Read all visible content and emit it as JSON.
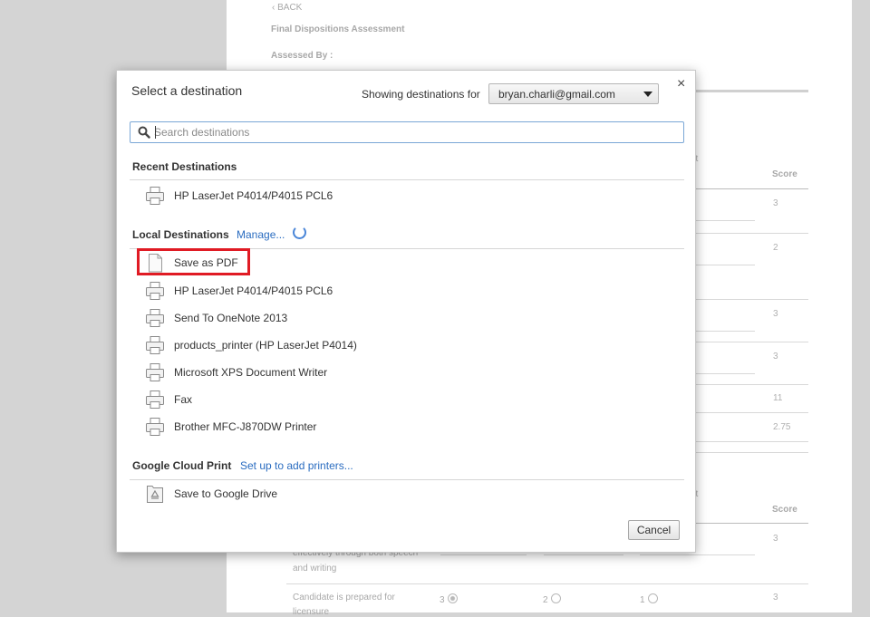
{
  "background": {
    "back_label": "BACK",
    "assessment_title": "Final Dispositions Assessment",
    "assessed_by": "Assessed By :",
    "score_header": "Score",
    "et_fragment": "et",
    "scores_upper": [
      "3",
      "2",
      "3",
      "3",
      "11",
      "2.75"
    ],
    "scores_lower": [
      "3",
      "3"
    ],
    "row_text_1": "effectively through both speech",
    "row_text_2": "and writing",
    "row_text_3": "Candidate is prepared for",
    "row_text_4": "licensure",
    "radio_labels": [
      "3",
      "2",
      "1"
    ]
  },
  "dialog": {
    "title": "Select a destination",
    "showing_for_label": "Showing destinations for",
    "account": "bryan.charli@gmail.com",
    "close_glyph": "×",
    "search_placeholder": "Search destinations",
    "recent": {
      "heading": "Recent Destinations",
      "items": [
        {
          "label": "HP LaserJet P4014/P4015 PCL6",
          "icon": "printer-icon"
        }
      ]
    },
    "local": {
      "heading": "Local Destinations",
      "manage_link": "Manage...",
      "items": [
        {
          "label": "Save as PDF",
          "icon": "document-icon"
        },
        {
          "label": "HP LaserJet P4014/P4015 PCL6",
          "icon": "printer-icon"
        },
        {
          "label": "Send To OneNote 2013",
          "icon": "printer-icon"
        },
        {
          "label": "products_printer (HP LaserJet P4014)",
          "icon": "printer-icon"
        },
        {
          "label": "Microsoft XPS Document Writer",
          "icon": "printer-icon"
        },
        {
          "label": "Fax",
          "icon": "printer-icon"
        },
        {
          "label": "Brother MFC-J870DW Printer",
          "icon": "printer-icon"
        }
      ]
    },
    "cloud": {
      "heading": "Google Cloud Print",
      "setup_link": "Set up to add printers...",
      "items": [
        {
          "label": "Save to Google Drive",
          "icon": "google-drive-icon"
        }
      ]
    },
    "cancel_label": "Cancel",
    "accent_color": "#2a6cc0",
    "highlight_color": "#e01b24"
  }
}
